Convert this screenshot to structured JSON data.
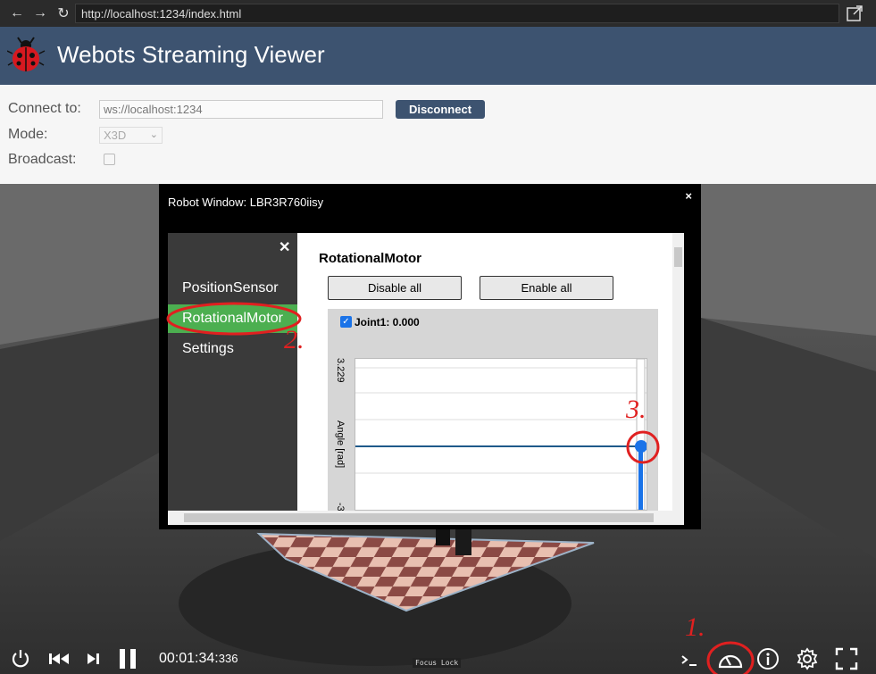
{
  "browser": {
    "url": "http://localhost:1234/index.html"
  },
  "header": {
    "title": "Webots Streaming Viewer"
  },
  "connection": {
    "connect_label": "Connect to:",
    "connect_value": "ws://localhost:1234",
    "disconnect_label": "Disconnect",
    "mode_label": "Mode:",
    "mode_value": "X3D",
    "broadcast_label": "Broadcast:"
  },
  "robot_window": {
    "title": "Robot Window: LBR3R760iisy",
    "close_glyph": "×",
    "menu_close_glyph": "✕",
    "menu_items": [
      {
        "label": "PositionSensor",
        "active": false
      },
      {
        "label": "RotationalMotor",
        "active": true
      },
      {
        "label": "Settings",
        "active": false
      }
    ],
    "section_title": "RotationalMotor",
    "disable_all_label": "Disable all",
    "enable_all_label": "Enable all",
    "joint": {
      "label": "Joint1: 0.000",
      "checked": true,
      "y_tick_top": "3.229",
      "y_axis_label": "Angle [rad]",
      "y_tick_bottom": "-3"
    }
  },
  "toolbar": {
    "time_main": "00:01:34:",
    "time_ms": "336",
    "focus_lock": "Focus Lock"
  },
  "annotations": {
    "step1": "1.",
    "step2": "2.",
    "step3": "3."
  },
  "colors": {
    "header_bg": "#3d5370",
    "menu_active": "#4caf50",
    "annotation": "#e02020",
    "plot_line": "#1f5a8a",
    "slider": "#1a73e8"
  }
}
